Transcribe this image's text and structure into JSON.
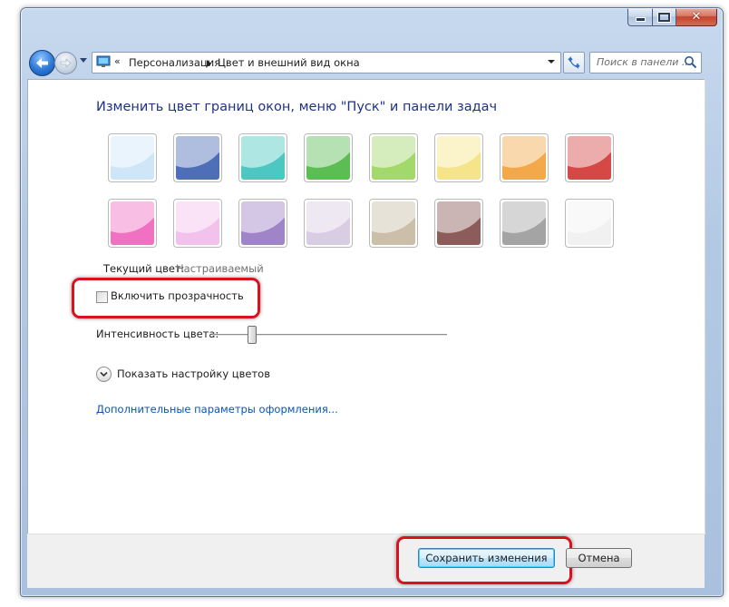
{
  "nav": {
    "breadcrumb_chevron": "«",
    "breadcrumbs": [
      "Персонализация",
      "Цвет и внешний вид окна"
    ],
    "search_placeholder": "Поиск в панели ..."
  },
  "main": {
    "title": "Изменить цвет границ окон, меню \"Пуск\" и панели задач",
    "swatches": [
      {
        "name": "sky",
        "color": "#cfe6f8"
      },
      {
        "name": "twilight",
        "color": "#4e6fb8"
      },
      {
        "name": "sea",
        "color": "#4cc7c2"
      },
      {
        "name": "leaf",
        "color": "#5dbd55"
      },
      {
        "name": "lime",
        "color": "#a3d86a"
      },
      {
        "name": "pumpkin-light",
        "color": "#f6e48a"
      },
      {
        "name": "pumpkin",
        "color": "#f3a84a"
      },
      {
        "name": "ruby",
        "color": "#d64846"
      },
      {
        "name": "fuchsia",
        "color": "#f070c2"
      },
      {
        "name": "blush",
        "color": "#f3c2ec"
      },
      {
        "name": "violet",
        "color": "#9f84c8"
      },
      {
        "name": "lavender",
        "color": "#d9cde3"
      },
      {
        "name": "taupe",
        "color": "#cbbfa9"
      },
      {
        "name": "chocolate",
        "color": "#8c5c5a"
      },
      {
        "name": "slate",
        "color": "#a4a4a4"
      },
      {
        "name": "frost",
        "color": "#f1f1f1"
      }
    ],
    "current_color_label": "Текущий цвет:",
    "current_color_value": "Настраиваемый",
    "transparency_label": "Включить прозрачность",
    "transparency_checked": false,
    "intensity_label": "Интенсивность цвета:",
    "intensity_level": 0.17,
    "show_mixer_label": "Показать настройку цветов",
    "advanced_link": "Дополнительные параметры оформления..."
  },
  "footer": {
    "save_label": "Сохранить изменения",
    "cancel_label": "Отмена"
  },
  "highlight_color": "#d6131f"
}
